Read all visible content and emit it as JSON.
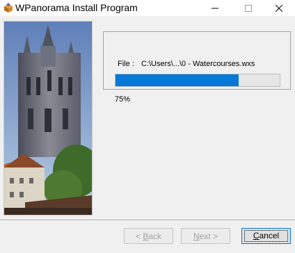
{
  "window": {
    "title": "WPanorama Install Program",
    "icon": "installer-box-icon"
  },
  "titlebar_buttons": {
    "minimize_icon": "minimize-icon",
    "maximize_icon": "maximize-icon",
    "close_icon": "close-icon"
  },
  "progress": {
    "file_label": "File :",
    "file_path": "C:\\Users\\...\\0 - Watercourses.wxs",
    "percent_text": "75%",
    "fraction": 0.75,
    "bar_color": "#0678d7"
  },
  "buttons": {
    "back_prefix": "< ",
    "back_access": "B",
    "back_rest": "ack",
    "next_access": "N",
    "next_rest": "ext >",
    "cancel_access": "C",
    "cancel_rest": "ancel"
  }
}
